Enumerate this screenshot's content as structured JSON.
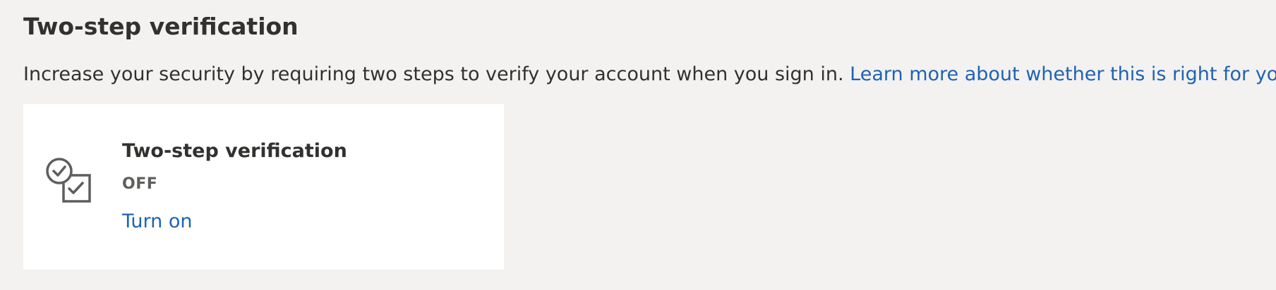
{
  "section": {
    "title": "Two-step verification",
    "description": "Increase your security by requiring two steps to verify your account when you sign in.",
    "learn_more_link": "Learn more about whether this is right for you."
  },
  "card": {
    "icon": "verification-checks-icon",
    "title": "Two-step verification",
    "status": "OFF",
    "action_label": "Turn on"
  },
  "colors": {
    "page_background": "#f3f2f1",
    "card_background": "#ffffff",
    "text_primary": "#323130",
    "text_secondary": "#605e5c",
    "link": "#1e63b3",
    "icon": "#605e5c"
  }
}
